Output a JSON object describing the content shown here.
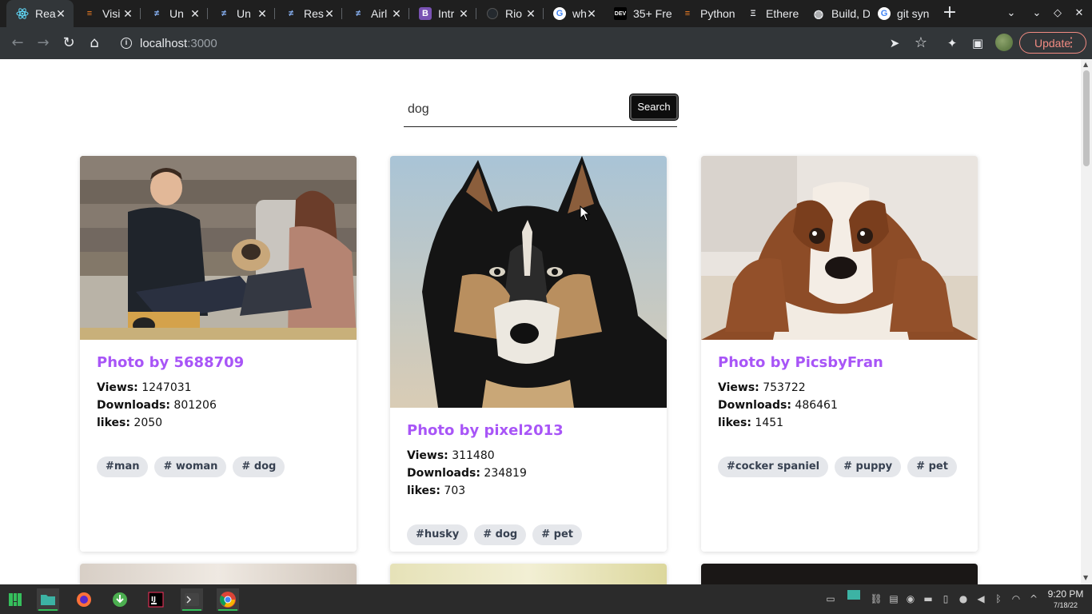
{
  "browser": {
    "tabs": [
      {
        "title": "Rea",
        "icon": "react-icon",
        "active": true
      },
      {
        "title": "Visi",
        "icon": "stackoverflow-icon"
      },
      {
        "title": "Un",
        "icon": "unsplash-like-icon"
      },
      {
        "title": "Un",
        "icon": "unsplash-like-icon"
      },
      {
        "title": "Res",
        "icon": "unsplash-like-icon"
      },
      {
        "title": "Airl",
        "icon": "unsplash-like-icon"
      },
      {
        "title": "Intr",
        "icon": "bootstrap-icon"
      },
      {
        "title": "Rio",
        "icon": "github-icon"
      },
      {
        "title": "wh",
        "icon": "google-icon"
      },
      {
        "title": "35+ Fre",
        "icon": "dev-icon"
      },
      {
        "title": "Python",
        "icon": "stackoverflow-icon"
      },
      {
        "title": "Ethere",
        "icon": "ethereum-icon"
      },
      {
        "title": "Build, D",
        "icon": "globe-icon"
      },
      {
        "title": "git syn",
        "icon": "google-icon"
      }
    ],
    "url_host": "localhost",
    "url_port": ":3000",
    "update_label": "Update"
  },
  "search": {
    "value": "dog",
    "button_label": "Search"
  },
  "cards": [
    {
      "title": "Photo by 5688709",
      "views_label": "Views:",
      "views": "1247031",
      "downloads_label": "Downloads:",
      "downloads": "801206",
      "likes_label": "likes:",
      "likes": "2050",
      "tags": [
        "#man",
        "# woman",
        "# dog"
      ]
    },
    {
      "title": "Photo by pixel2013",
      "views_label": "Views:",
      "views": "311480",
      "downloads_label": "Downloads:",
      "downloads": "234819",
      "likes_label": "likes:",
      "likes": "703",
      "tags": [
        "#husky",
        "# dog",
        "# pet"
      ]
    },
    {
      "title": "Photo by PicsbyFran",
      "views_label": "Views:",
      "views": "753722",
      "downloads_label": "Downloads:",
      "downloads": "486461",
      "likes_label": "likes:",
      "likes": "1451",
      "tags": [
        "#cocker spaniel",
        "# puppy",
        "# pet"
      ]
    }
  ],
  "taskbar": {
    "time": "9:20 PM",
    "date": "7/18/22"
  },
  "colors": {
    "accent": "#a855f7",
    "tag_bg": "#e5e7eb",
    "update_text": "#f28b82"
  }
}
